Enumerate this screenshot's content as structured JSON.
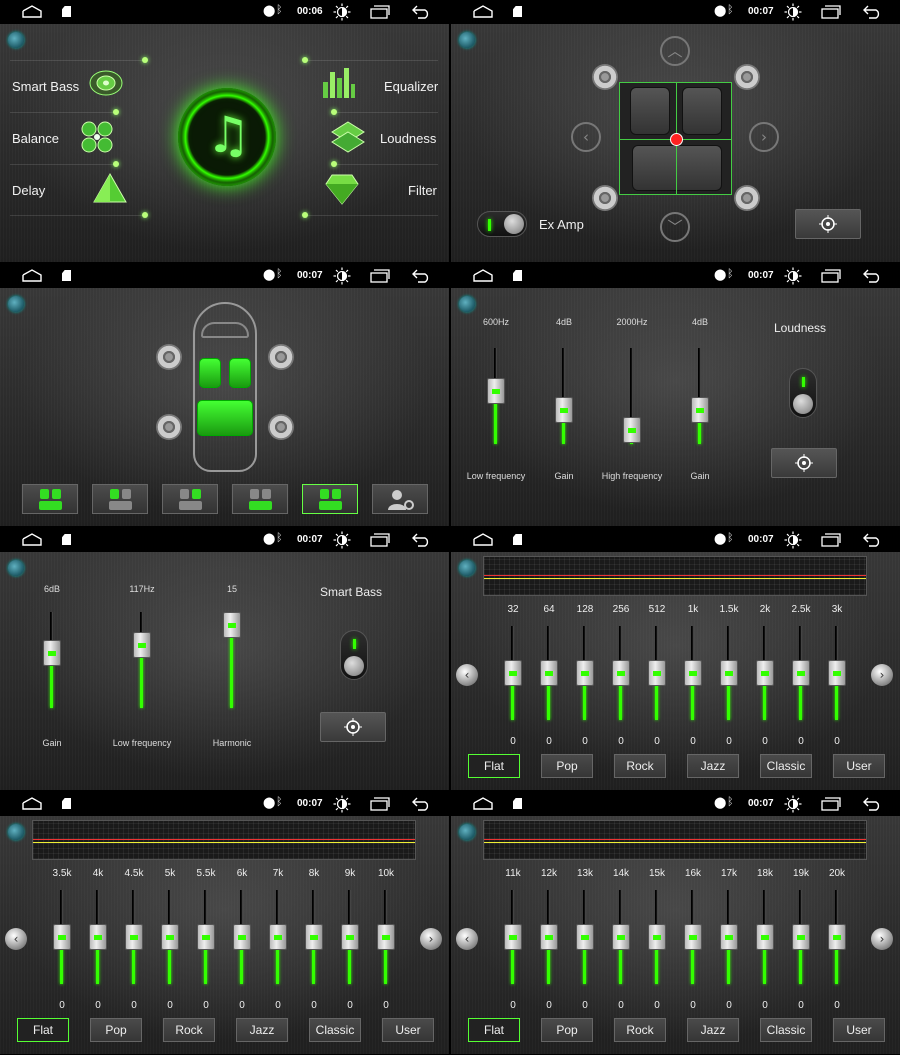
{
  "status": {
    "panels": [
      {
        "time": "00:06"
      },
      {
        "time": "00:07"
      },
      {
        "time": "00:07"
      },
      {
        "time": "00:07"
      },
      {
        "time": "00:07"
      },
      {
        "time": "00:07"
      },
      {
        "time": "00:07"
      },
      {
        "time": "00:07"
      }
    ]
  },
  "audio_menu": {
    "left": [
      {
        "label": "Smart Bass",
        "icon": "smart-bass-icon"
      },
      {
        "label": "Balance",
        "icon": "balance-icon"
      },
      {
        "label": "Delay",
        "icon": "delay-pyramid-icon"
      }
    ],
    "right": [
      {
        "label": "Equalizer",
        "icon": "equalizer-icon"
      },
      {
        "label": "Loudness",
        "icon": "loudness-icon"
      },
      {
        "label": "Filter",
        "icon": "filter-gem-icon"
      }
    ],
    "center_icon": "music-note-icon"
  },
  "balance": {
    "ex_amp_label": "Ex Amp",
    "ex_amp_on": true
  },
  "delay": {
    "seat_presets": [
      "all",
      "driver",
      "front-passenger",
      "rear",
      "custom-all",
      "user-settings"
    ],
    "active_preset_index": 4
  },
  "loudness": {
    "title": "Loudness",
    "sliders": [
      {
        "value": "600Hz",
        "label": "Low frequency",
        "level": 0.57
      },
      {
        "value": "4dB",
        "label": "Gain",
        "level": 0.3
      },
      {
        "value": "2000Hz",
        "label": "High frequency",
        "level": 0.02
      },
      {
        "value": "4dB",
        "label": "Gain",
        "level": 0.3
      }
    ],
    "enabled": true
  },
  "smart_bass": {
    "title": "Smart Bass",
    "sliders": [
      {
        "value": "6dB",
        "label": "Gain",
        "level": 0.6
      },
      {
        "value": "117Hz",
        "label": "Low frequency",
        "level": 0.72
      },
      {
        "value": "15",
        "label": "Harmonic",
        "level": 1.0
      }
    ],
    "enabled": true
  },
  "equalizer": {
    "pages": [
      {
        "bands": [
          "32",
          "64",
          "128",
          "256",
          "512",
          "1k",
          "1.5k",
          "2k",
          "2.5k",
          "3k"
        ]
      },
      {
        "bands": [
          "3.5k",
          "4k",
          "4.5k",
          "5k",
          "5.5k",
          "6k",
          "7k",
          "8k",
          "9k",
          "10k"
        ]
      },
      {
        "bands": [
          "11k",
          "12k",
          "13k",
          "14k",
          "15k",
          "16k",
          "17k",
          "18k",
          "19k",
          "20k"
        ]
      }
    ],
    "band_value": "0",
    "presets": [
      "Flat",
      "Pop",
      "Rock",
      "Jazz",
      "Classic",
      "User"
    ],
    "active_preset": "Flat"
  },
  "colors": {
    "accent_green": "#33ff00",
    "eq_line_red": "#ee3333",
    "eq_line_yellow": "#eeee33"
  }
}
